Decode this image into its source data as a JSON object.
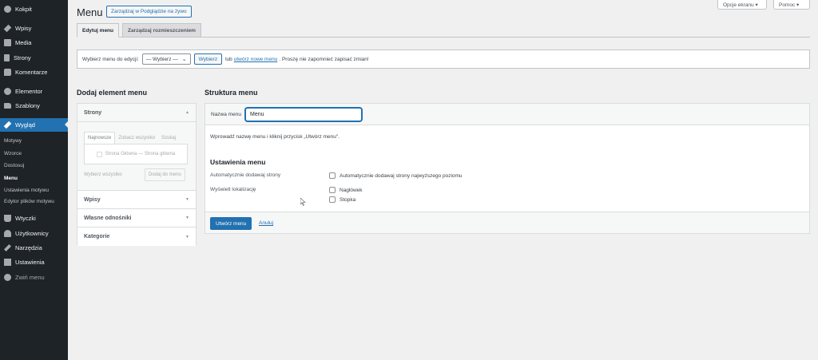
{
  "sidebar": {
    "items": [
      {
        "label": "Kokpit",
        "icon": "dashboard-icon"
      },
      {
        "label": "Wpisy",
        "icon": "pin-icon"
      },
      {
        "label": "Media",
        "icon": "media-icon"
      },
      {
        "label": "Strony",
        "icon": "page-icon"
      },
      {
        "label": "Komentarze",
        "icon": "comment-icon"
      },
      {
        "label": "Elementor",
        "icon": "elementor-icon"
      },
      {
        "label": "Szablony",
        "icon": "folder-icon"
      },
      {
        "label": "Wygląd",
        "icon": "brush-icon"
      },
      {
        "label": "Wtyczki",
        "icon": "plugin-icon"
      },
      {
        "label": "Użytkownicy",
        "icon": "users-icon"
      },
      {
        "label": "Narzędzia",
        "icon": "tools-icon"
      },
      {
        "label": "Ustawienia",
        "icon": "settings-icon"
      },
      {
        "label": "Zwiń menu",
        "icon": "collapse-icon"
      }
    ],
    "submenu": [
      "Motywy",
      "Wzorce",
      "Dostosuj",
      "Menu",
      "Ustawienia motywu",
      "Edytor plików motywu"
    ]
  },
  "header": {
    "screen_options": "Opcje ekranu ▾",
    "help": "Pomoc ▾",
    "title": "Menu",
    "manage_live": "Zarządzaj w Podglądzie na żywo"
  },
  "tabs": [
    "Edytuj menu",
    "Zarządzaj rozmieszczeniem"
  ],
  "select_bar": {
    "label": "Wybierz menu do edycji:",
    "select_value": "— Wybierz —",
    "button": "Wybierz",
    "or": "lub",
    "create_link": "utwórz nowe menu",
    "reminder": ". Proszę nie zapomnieć zapisać zmian!"
  },
  "left": {
    "title": "Dodaj element menu",
    "pages_heading": "Strony",
    "subtabs": [
      "Najnowsze",
      "Zobacz wszystko",
      "Szukaj"
    ],
    "page_item": "Strona Główna — Strona główna",
    "select_all": "Wybierz wszystko",
    "add_button": "Dodaj do menu",
    "sections": [
      "Wpisy",
      "Własne odnośniki",
      "Kategorie"
    ]
  },
  "right": {
    "title": "Struktura menu",
    "name_label": "Nazwa menu",
    "name_value": "Menu",
    "hint": "Wprowadź nazwę menu i kliknij przycisk „Utwórz menu\".",
    "settings_title": "Ustawienia menu",
    "auto_add_label": "Automatycznie dodawaj strony",
    "auto_add_option": "Automatycznie dodawaj strony najwyższego poziomu",
    "locations_label": "Wyświetl lokalizację",
    "locations": [
      "Nagłówek",
      "Stopka"
    ],
    "create_button": "Utwórz menu",
    "cancel": "Anuluj"
  },
  "colors": {
    "accent": "#2271b1",
    "sidebar": "#1d2327",
    "background": "#f0f0f1"
  }
}
